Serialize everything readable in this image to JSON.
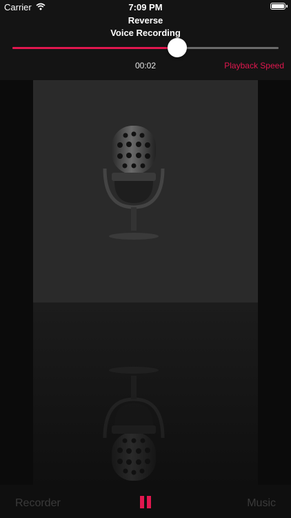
{
  "status": {
    "carrier": "Carrier",
    "time": "7:09 PM"
  },
  "header": {
    "title_line1": "Reverse",
    "title_line2": "Voice Recording",
    "elapsed": "00:02",
    "playback_speed_label": "Playback Speed",
    "progress_fraction": 0.62
  },
  "tabbar": {
    "recorder_label": "Recorder",
    "music_label": "Music"
  },
  "icons": {
    "status": [
      "wifi-icon",
      "battery-icon"
    ],
    "main": [
      "microphone-icon",
      "pause-icon"
    ]
  },
  "colors": {
    "accent": "#e1174f",
    "header_bg": "#141414",
    "panel_bg": "#2a2a2a"
  }
}
